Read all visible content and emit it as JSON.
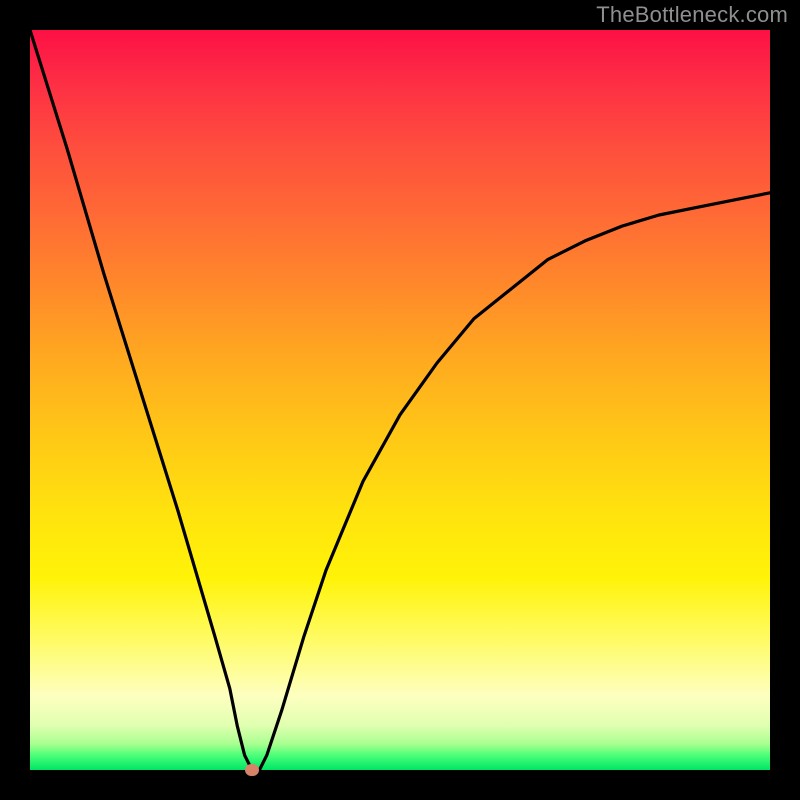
{
  "watermark": "TheBottleneck.com",
  "colors": {
    "background": "#000000",
    "watermark_text": "#8f8f8f",
    "curve": "#000000",
    "marker": "#d6836a",
    "gradient_stops": [
      "#fd1045",
      "#fd2a45",
      "#fe4b3e",
      "#ff6a35",
      "#ff8a2a",
      "#ffab1f",
      "#ffc816",
      "#ffe20e",
      "#fff308",
      "#fffb60",
      "#fdffc0",
      "#e0ffb0",
      "#a8ff90",
      "#4cff78",
      "#00e565"
    ]
  },
  "chart_data": {
    "type": "line",
    "title": "",
    "xlabel": "",
    "ylabel": "",
    "xlim": [
      0,
      100
    ],
    "ylim": [
      0,
      100
    ],
    "grid": false,
    "curve_description": "V-shaped bottleneck curve: steep near-linear descent on the left, a sharp minimum near x≈30 at y≈0, then a concave rise flattening toward the right",
    "series": [
      {
        "name": "bottleneck-curve",
        "x": [
          0,
          5,
          10,
          15,
          20,
          25,
          27,
          28,
          29,
          30,
          31,
          32,
          34,
          37,
          40,
          45,
          50,
          55,
          60,
          65,
          70,
          75,
          80,
          85,
          90,
          95,
          100
        ],
        "y": [
          100,
          84,
          67,
          51,
          35,
          18,
          11,
          6,
          2,
          0,
          0,
          2,
          8,
          18,
          27,
          39,
          48,
          55,
          61,
          65,
          69,
          71.5,
          73.5,
          75,
          76,
          77,
          78
        ]
      }
    ],
    "optimal_point": {
      "x": 30,
      "y": 0
    }
  }
}
